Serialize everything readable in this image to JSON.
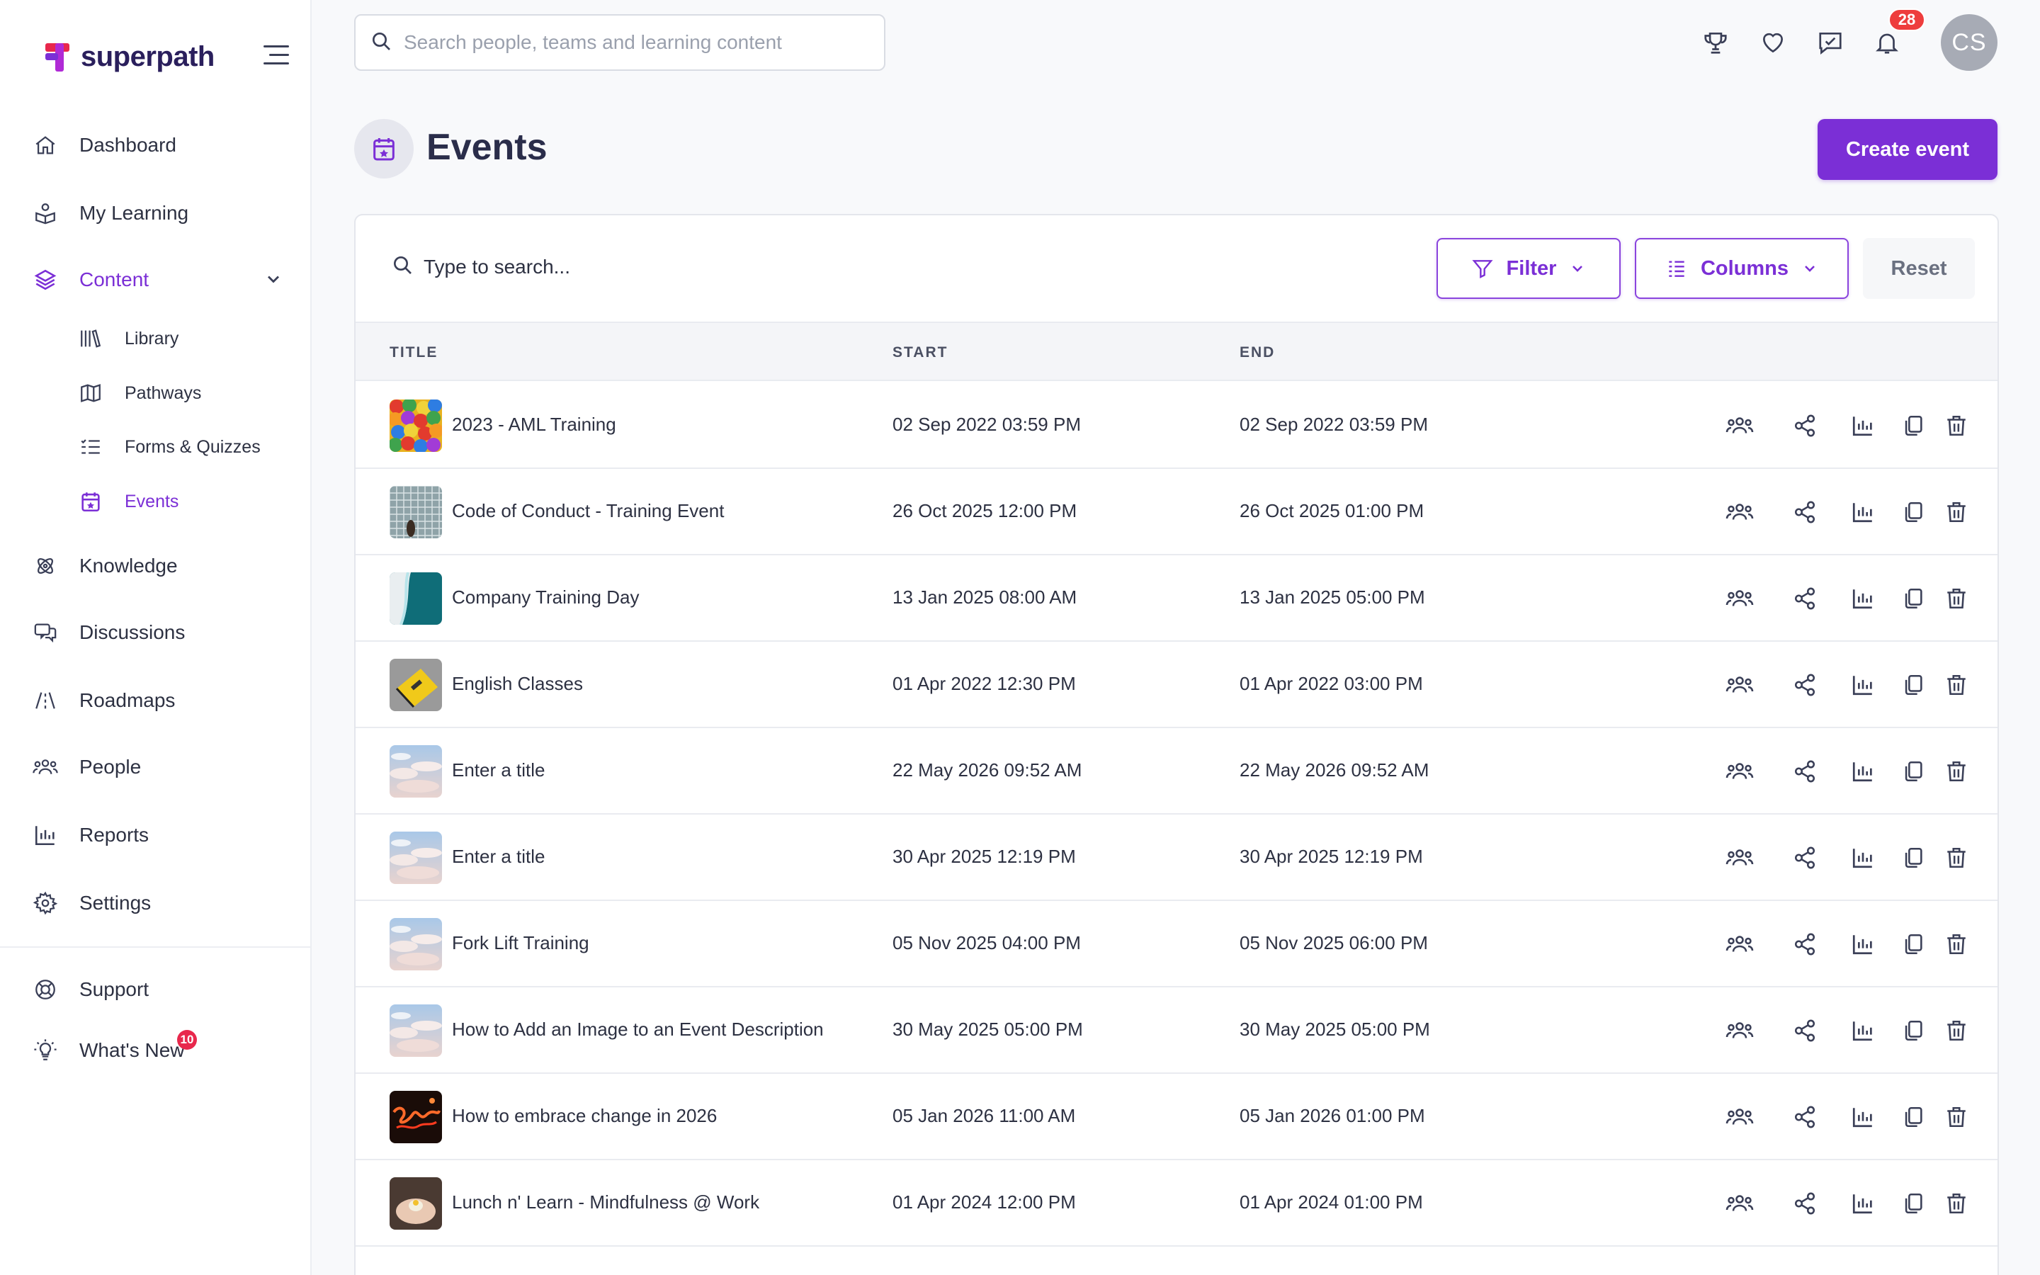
{
  "brand": {
    "name": "superpath"
  },
  "sidebar": {
    "items": [
      {
        "label": "Dashboard",
        "icon": "home-icon"
      },
      {
        "label": "My Learning",
        "icon": "learning-icon"
      },
      {
        "label": "Content",
        "icon": "layers-icon"
      },
      {
        "label": "Knowledge",
        "icon": "atom-icon"
      },
      {
        "label": "Discussions",
        "icon": "chat-icon"
      },
      {
        "label": "Roadmaps",
        "icon": "road-icon"
      },
      {
        "label": "People",
        "icon": "people-icon"
      },
      {
        "label": "Reports",
        "icon": "chart-icon"
      },
      {
        "label": "Settings",
        "icon": "gear-icon"
      }
    ],
    "content_sub": [
      {
        "label": "Library",
        "icon": "library-icon"
      },
      {
        "label": "Pathways",
        "icon": "map-icon"
      },
      {
        "label": "Forms & Quizzes",
        "icon": "checklist-icon"
      },
      {
        "label": "Events",
        "icon": "calendar-icon"
      }
    ],
    "bottom": [
      {
        "label": "Support",
        "icon": "lifebuoy-icon"
      },
      {
        "label": "What's New",
        "icon": "lightbulb-icon",
        "badge": "10"
      }
    ]
  },
  "topbar": {
    "search_placeholder": "Search people, teams and learning content",
    "notification_count": "28",
    "avatar_initials": "CS"
  },
  "page": {
    "title": "Events",
    "create_label": "Create event"
  },
  "table": {
    "search_placeholder": "Type to search...",
    "filter_label": "Filter",
    "columns_label": "Columns",
    "reset_label": "Reset",
    "headers": [
      "TITLE",
      "START",
      "END"
    ],
    "rows": [
      {
        "title": "2023 - AML Training",
        "start": "02 Sep 2022 03:59 PM",
        "end": "02 Sep 2022 03:59 PM",
        "thumb": "balls"
      },
      {
        "title": "Code of Conduct - Training Event",
        "start": "26 Oct 2025 12:00 PM",
        "end": "26 Oct 2025 01:00 PM",
        "thumb": "grid"
      },
      {
        "title": "Company Training Day",
        "start": "13 Jan 2025 08:00 AM",
        "end": "13 Jan 2025 05:00 PM",
        "thumb": "ocean"
      },
      {
        "title": "English Classes",
        "start": "01 Apr 2022 12:30 PM",
        "end": "01 Apr 2022 03:00 PM",
        "thumb": "book"
      },
      {
        "title": "Enter a title",
        "start": "22 May 2026 09:52 AM",
        "end": "22 May 2026 09:52 AM",
        "thumb": "sky"
      },
      {
        "title": "Enter a title",
        "start": "30 Apr 2025 12:19 PM",
        "end": "30 Apr 2025 12:19 PM",
        "thumb": "sky"
      },
      {
        "title": "Fork Lift Training",
        "start": "05 Nov 2025 04:00 PM",
        "end": "05 Nov 2025 06:00 PM",
        "thumb": "sky"
      },
      {
        "title": "How to Add an Image to an Event Description",
        "start": "30 May 2025 05:00 PM",
        "end": "30 May 2025 05:00 PM",
        "thumb": "sky"
      },
      {
        "title": "How to embrace change in 2026",
        "start": "05 Jan 2026 11:00 AM",
        "end": "05 Jan 2026 01:00 PM",
        "thumb": "neon"
      },
      {
        "title": "Lunch n' Learn - Mindfulness @ Work",
        "start": "01 Apr 2024 12:00 PM",
        "end": "01 Apr 2024 01:00 PM",
        "thumb": "hands"
      }
    ],
    "row_actions": [
      "attendees-icon",
      "share-icon",
      "report-icon",
      "duplicate-icon",
      "delete-icon"
    ]
  },
  "colors": {
    "accent": "#7b2fd6",
    "text": "#2d3142",
    "badge": "#ee3d3d"
  }
}
